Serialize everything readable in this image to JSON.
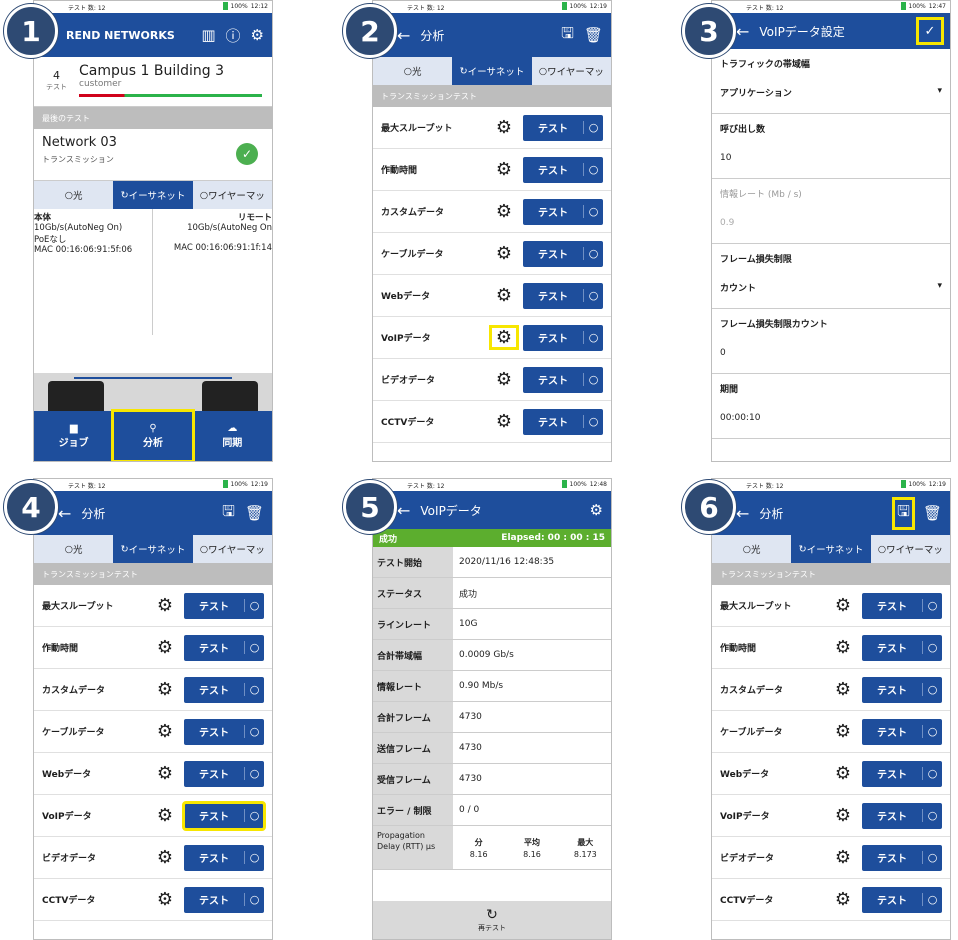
{
  "badges": [
    "1",
    "2",
    "3",
    "4",
    "5",
    "6"
  ],
  "status": {
    "left": "テスト 数: 12",
    "battery": "100%",
    "t1": "12:12",
    "t2": "12:19",
    "t3": "12:47",
    "t5": "12:48"
  },
  "s1": {
    "brand": "REND NETWORKS",
    "project_count": "4",
    "project_count_label": "テスト",
    "project_name": "Campus 1 Building 3",
    "project_sub": "customer",
    "last_test_section": "最後のテスト",
    "network_name": "Network 03",
    "network_type": "トランスミッション",
    "tabs": [
      "光",
      "イーサネット",
      "ワイヤーマッ"
    ],
    "main_label": "本体",
    "remote_label": "リモート",
    "main_speed": "10Gb/s(AutoNeg On)",
    "remote_speed": "10Gb/s(AutoNeg On",
    "poe": "PoEなし",
    "main_mac": "MAC 00:16:06:91:5f:06",
    "remote_mac": "MAC 00:16:06:91:1f:14",
    "footer": [
      "ジョブ",
      "分析",
      "同期"
    ]
  },
  "analysis": {
    "title": "分析",
    "tabs": [
      "光",
      "イーサネット",
      "ワイヤーマッ"
    ],
    "section": "トランスミッションテスト",
    "tests": [
      "最大スループット",
      "作動時間",
      "カスタムデータ",
      "ケーブルデータ",
      "Webデータ",
      "VoIPデータ",
      "ビデオデータ",
      "CCTVデータ"
    ],
    "test_label": "テスト"
  },
  "s3": {
    "title": "VoIPデータ設定",
    "f1_cap": "トラフィックの帯域幅",
    "f1_val": "アプリケーション",
    "f2_cap": "呼び出し数",
    "f2_val": "10",
    "f3_cap": "情報レート (Mb / s)",
    "f3_val": "0.9",
    "f4_cap": "フレーム損失制限",
    "f4_val": "カウント",
    "f5_cap": "フレーム損失制限カウント",
    "f5_val": "0",
    "f6_cap": "期間",
    "f6_val": "00:00:10"
  },
  "s5": {
    "title": "VoIPデータ",
    "result": "成功",
    "elapsed": "Elapsed: 00 : 00 : 15",
    "rows": [
      [
        "テスト開始",
        "2020/11/16 12:48:35"
      ],
      [
        "ステータス",
        "成功"
      ],
      [
        "ラインレート",
        "10G"
      ],
      [
        "合計帯域幅",
        "0.0009 Gb/s"
      ],
      [
        "情報レート",
        "0.90 Mb/s"
      ],
      [
        "合計フレーム",
        "4730"
      ],
      [
        "送信フレーム",
        "4730"
      ],
      [
        "受信フレーム",
        "4730"
      ],
      [
        "エラー / 制限",
        "0 / 0"
      ]
    ],
    "pct": "100%",
    "pd_label": "Propagation Delay (RTT) μs",
    "pd_heads": [
      "分",
      "平均",
      "最大"
    ],
    "pd_vals": [
      "8.16",
      "8.16",
      "8.173"
    ],
    "retest": "再テスト"
  }
}
